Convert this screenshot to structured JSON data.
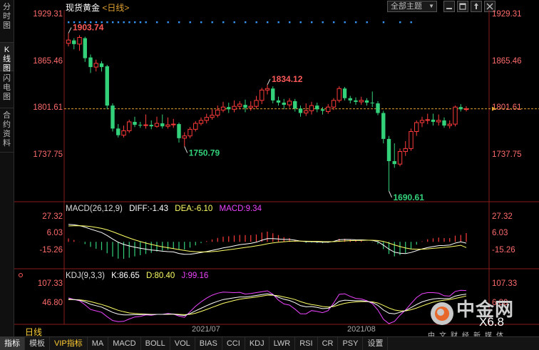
{
  "sidebar": {
    "tabs": [
      {
        "label": "分时图",
        "active": false
      },
      {
        "label": "K线图",
        "active": true
      },
      {
        "label": "闪电图",
        "active": false
      },
      {
        "label": "合约资料",
        "active": false
      }
    ]
  },
  "header": {
    "name": "现货黄金",
    "period": "<日线>",
    "theme_button": "全部主题",
    "theme_arrow": "▼"
  },
  "price_axis": {
    "labels": [
      "1929.31",
      "1865.46",
      "1801.61",
      "1737.75"
    ]
  },
  "price_annotations": {
    "high": "1903.74",
    "mid_high": "1834.12",
    "low1": "1750.79",
    "low2": "1690.61"
  },
  "macd": {
    "name": "MACD(26,12,9)",
    "diff": "DIFF:-1.43",
    "dea": "DEA:-6.10",
    "macd": "MACD:9.34",
    "axis_labels": [
      "27.32",
      "6.03",
      "-15.26"
    ]
  },
  "kdj": {
    "name": "KDJ(9,3,3)",
    "k": "K:86.65",
    "d": "D:80.40",
    "j": "J:99.16",
    "axis_labels": [
      "107.33",
      "46.80"
    ],
    "right_axis_labels": [
      "107.33",
      "6.80"
    ]
  },
  "time_axis": {
    "period_label": "日线",
    "dates": [
      "2021/07",
      "2021/08"
    ]
  },
  "bottom_tabs": [
    {
      "label": "指标",
      "active": true,
      "vip": false
    },
    {
      "label": "模板",
      "active": false,
      "vip": false
    },
    {
      "label": "VIP指标",
      "active": false,
      "vip": true
    },
    {
      "label": "MA",
      "active": false,
      "vip": false
    },
    {
      "label": "MACD",
      "active": false,
      "vip": false
    },
    {
      "label": "BOLL",
      "active": false,
      "vip": false
    },
    {
      "label": "VOL",
      "active": false,
      "vip": false
    },
    {
      "label": "BIAS",
      "active": false,
      "vip": false
    },
    {
      "label": "CCI",
      "active": false,
      "vip": false
    },
    {
      "label": "KDJ",
      "active": false,
      "vip": false
    },
    {
      "label": "LWR",
      "active": false,
      "vip": false
    },
    {
      "label": "RSI",
      "active": false,
      "vip": false
    },
    {
      "label": "CR",
      "active": false,
      "vip": false
    },
    {
      "label": "PSY",
      "active": false,
      "vip": false
    },
    {
      "label": "设置",
      "active": false,
      "vip": false
    }
  ],
  "watermark": {
    "brand": "中金网",
    "sub": "中文财经新媒体",
    "num": "X6.8"
  },
  "colors": {
    "up": "#ff3b3b",
    "down": "#33d17a",
    "axis_text": "#ff6b6b",
    "k_line": "#ffffff",
    "d_line": "#ffff66",
    "j_line": "#ee44ff",
    "dot": "#3399ff"
  },
  "chart_data": [
    {
      "type": "candlestick",
      "title": "现货黄金 <日线>",
      "ylim": [
        1690.61,
        1929.31
      ],
      "annotations": {
        "high": 1903.74,
        "mid_high": 1834.12,
        "low1": 1750.79,
        "low2": 1690.61
      },
      "current_price": 1801.61,
      "candles": [
        [
          1890.0,
          1894.5,
          1886.0,
          1903.74
        ],
        [
          1894.0,
          1889.0,
          1882.0,
          1897.0
        ],
        [
          1889.0,
          1898.0,
          1880.0,
          1901.0
        ],
        [
          1897.0,
          1870.0,
          1865.0,
          1899.0
        ],
        [
          1871.0,
          1858.0,
          1850.0,
          1875.0
        ],
        [
          1858.0,
          1863.0,
          1852.0,
          1868.0
        ],
        [
          1863.0,
          1858.0,
          1852.0,
          1866.0
        ],
        [
          1859.0,
          1806.0,
          1801.0,
          1861.0
        ],
        [
          1806.0,
          1775.0,
          1771.0,
          1809.0
        ],
        [
          1775.0,
          1766.0,
          1763.0,
          1781.0
        ],
        [
          1766.0,
          1772.0,
          1763.0,
          1779.0
        ],
        [
          1772.0,
          1784.0,
          1769.0,
          1787.0
        ],
        [
          1784.0,
          1780.0,
          1777.0,
          1791.0
        ],
        [
          1780.0,
          1779.0,
          1776.0,
          1784.0
        ],
        [
          1780.0,
          1780.0,
          1775.0,
          1794.0
        ],
        [
          1780.0,
          1778.0,
          1774.0,
          1786.0
        ],
        [
          1778.0,
          1782.0,
          1776.0,
          1791.0
        ],
        [
          1782.0,
          1778.0,
          1775.0,
          1794.0
        ],
        [
          1778.0,
          1780.0,
          1775.0,
          1790.0
        ],
        [
          1780.0,
          1781.0,
          1776.0,
          1788.0
        ],
        [
          1781.0,
          1762.0,
          1756.0,
          1783.0
        ],
        [
          1762.0,
          1765.0,
          1750.79,
          1770.0
        ],
        [
          1765.0,
          1774.0,
          1762.0,
          1777.0
        ],
        [
          1774.0,
          1782.0,
          1771.0,
          1785.0
        ],
        [
          1782.0,
          1786.0,
          1779.0,
          1790.0
        ],
        [
          1786.0,
          1790.0,
          1782.0,
          1795.0
        ],
        [
          1790.0,
          1793.0,
          1787.0,
          1801.0
        ],
        [
          1793.0,
          1800.0,
          1790.0,
          1806.0
        ],
        [
          1800.0,
          1804.0,
          1797.0,
          1811.0
        ],
        [
          1804.0,
          1801.0,
          1796.0,
          1810.0
        ],
        [
          1801.0,
          1805.0,
          1797.0,
          1813.0
        ],
        [
          1805.0,
          1808.0,
          1801.0,
          1812.0
        ],
        [
          1807.0,
          1803.0,
          1797.0,
          1814.0
        ],
        [
          1803.0,
          1805.0,
          1799.0,
          1812.0
        ],
        [
          1805.0,
          1813.0,
          1802.0,
          1819.0
        ],
        [
          1813.0,
          1827.0,
          1808.0,
          1830.0
        ],
        [
          1827.0,
          1829.0,
          1821.0,
          1834.12
        ],
        [
          1829.0,
          1813.0,
          1809.0,
          1832.0
        ],
        [
          1813.0,
          1810.0,
          1806.0,
          1818.0
        ],
        [
          1810.0,
          1807.0,
          1801.0,
          1815.0
        ],
        [
          1807.0,
          1812.0,
          1803.0,
          1816.0
        ],
        [
          1812.0,
          1802.0,
          1798.0,
          1815.0
        ],
        [
          1802.0,
          1796.0,
          1791.0,
          1806.0
        ],
        [
          1796.0,
          1799.0,
          1792.0,
          1809.0
        ],
        [
          1799.0,
          1806.0,
          1794.0,
          1811.0
        ],
        [
          1806.0,
          1801.0,
          1797.0,
          1810.0
        ],
        [
          1801.0,
          1799.0,
          1794.0,
          1804.0
        ],
        [
          1798.0,
          1804.0,
          1795.0,
          1808.0
        ],
        [
          1804.0,
          1813.0,
          1800.0,
          1816.0
        ],
        [
          1813.0,
          1829.0,
          1810.0,
          1832.0
        ],
        [
          1829.0,
          1816.0,
          1813.0,
          1831.0
        ],
        [
          1816.0,
          1813.0,
          1809.0,
          1819.0
        ],
        [
          1813.0,
          1811.0,
          1807.0,
          1817.0
        ],
        [
          1811.0,
          1813.0,
          1807.0,
          1818.0
        ],
        [
          1813.0,
          1810.0,
          1806.0,
          1816.0
        ],
        [
          1810.0,
          1809.0,
          1804.0,
          1825.0
        ],
        [
          1809.0,
          1796.0,
          1793.0,
          1812.0
        ],
        [
          1796.0,
          1761.0,
          1755.0,
          1799.0
        ],
        [
          1761.0,
          1731.0,
          1690.61,
          1765.0
        ],
        [
          1731.0,
          1727.0,
          1722.0,
          1755.0
        ],
        [
          1727.0,
          1744.0,
          1724.0,
          1748.0
        ],
        [
          1744.0,
          1748.0,
          1738.0,
          1758.0
        ],
        [
          1748.0,
          1771.0,
          1745.0,
          1775.0
        ],
        [
          1771.0,
          1783.0,
          1765.0,
          1786.0
        ],
        [
          1783.0,
          1786.0,
          1777.0,
          1791.0
        ],
        [
          1786.0,
          1787.0,
          1781.0,
          1795.0
        ],
        [
          1787.0,
          1784.0,
          1779.0,
          1795.0
        ],
        [
          1784.0,
          1786.0,
          1779.0,
          1794.0
        ],
        [
          1786.0,
          1779.0,
          1776.0,
          1790.0
        ],
        [
          1779.0,
          1781.0,
          1775.0,
          1786.0
        ],
        [
          1781.0,
          1804.0,
          1778.0,
          1806.0
        ],
        [
          1804.0,
          1801.0,
          1798.0,
          1808.0
        ],
        [
          1801.0,
          1801.61,
          1798.0,
          1805.0
        ]
      ]
    },
    {
      "type": "bar",
      "name": "MACD(26,12,9)",
      "ylim": [
        -25,
        30
      ],
      "series": [
        {
          "name": "DIFF",
          "values": [
            18.8,
            18.2,
            17.4,
            15.8,
            13.7,
            11.8,
            10.0,
            6.8,
            3.0,
            -0.4,
            -2.8,
            -4.4,
            -5.7,
            -6.8,
            -7.8,
            -8.7,
            -9.3,
            -10.0,
            -10.5,
            -10.8,
            -12.5,
            -13.4,
            -13.2,
            -12.5,
            -11.5,
            -10.4,
            -9.2,
            -7.9,
            -6.5,
            -5.5,
            -4.3,
            -3.1,
            -2.4,
            -1.6,
            -0.4,
            1.7,
            3.4,
            3.4,
            3.1,
            2.6,
            2.6,
            1.8,
            0.8,
            0.2,
            0.2,
            -0.1,
            -0.4,
            -0.3,
            0.5,
            2.2,
            2.6,
            2.5,
            2.2,
            2.1,
            1.8,
            1.5,
            0.2,
            -3.5,
            -7.8,
            -11.1,
            -12.2,
            -12.6,
            -11.4,
            -9.4,
            -7.6,
            -6.1,
            -5.1,
            -4.1,
            -3.9,
            -3.4,
            -1.3,
            0.0,
            -1.43
          ]
        },
        {
          "name": "DEA",
          "values": [
            17.0,
            17.2,
            17.3,
            17.0,
            16.4,
            15.5,
            14.4,
            12.9,
            10.9,
            8.6,
            6.3,
            4.1,
            2.1,
            0.3,
            -1.3,
            -2.8,
            -4.1,
            -5.3,
            -6.3,
            -7.2,
            -8.3,
            -9.3,
            -10.1,
            -10.6,
            -10.8,
            -10.8,
            -10.5,
            -10.0,
            -9.3,
            -8.5,
            -7.7,
            -6.8,
            -6.0,
            -5.2,
            -4.3,
            -3.3,
            -2.1,
            -1.2,
            -0.5,
            0.1,
            0.6,
            0.8,
            0.8,
            0.7,
            0.6,
            0.5,
            0.3,
            0.2,
            0.2,
            0.6,
            1.0,
            1.3,
            1.5,
            1.6,
            1.7,
            1.7,
            1.4,
            0.4,
            -1.3,
            -3.3,
            -5.1,
            -6.6,
            -7.6,
            -7.9,
            -7.9,
            -7.5,
            -7.0,
            -6.4,
            -5.9,
            -5.4,
            -4.6,
            -3.7,
            -6.1
          ]
        },
        {
          "name": "MACD",
          "values": [
            3.6,
            2.0,
            0.2,
            -2.4,
            -5.4,
            -7.4,
            -8.8,
            -12.2,
            -15.8,
            -18.0,
            -18.2,
            -17.0,
            -15.6,
            -14.2,
            -13.0,
            -11.8,
            -10.4,
            -9.4,
            -8.4,
            -7.2,
            -8.4,
            -8.2,
            -6.2,
            -3.8,
            -1.4,
            0.8,
            2.6,
            4.2,
            5.6,
            6.0,
            6.8,
            7.4,
            7.2,
            7.2,
            7.8,
            10.0,
            11.0,
            9.2,
            7.2,
            5.0,
            4.0,
            2.0,
            0.0,
            -1.0,
            -0.8,
            -1.2,
            -1.4,
            -1.0,
            0.6,
            3.2,
            3.2,
            2.4,
            1.4,
            1.0,
            0.2,
            -0.4,
            -2.4,
            -7.8,
            -13.0,
            -15.6,
            -14.2,
            -12.0,
            -7.6,
            -3.0,
            0.6,
            2.8,
            3.8,
            4.6,
            4.0,
            4.0,
            6.6,
            7.4,
            9.34
          ]
        }
      ]
    },
    {
      "type": "line",
      "name": "KDJ(9,3,3)",
      "ylim": [
        -10,
        130
      ],
      "series": [
        {
          "name": "K",
          "values": [
            70,
            68,
            66,
            60,
            52,
            47,
            42,
            33,
            24,
            18,
            15,
            15,
            16,
            16,
            17,
            16,
            17,
            17,
            18,
            18,
            15,
            13,
            20,
            29,
            38,
            47,
            55,
            62,
            68,
            71,
            74,
            77,
            77,
            79,
            82,
            85,
            88,
            84,
            76,
            69,
            65,
            57,
            47,
            43,
            44,
            41,
            37,
            38,
            48,
            62,
            66,
            65,
            64,
            64,
            62,
            58,
            48,
            32,
            21,
            19,
            24,
            30,
            40,
            51,
            60,
            66,
            70,
            72,
            71,
            72,
            80,
            84,
            86.65
          ]
        },
        {
          "name": "D",
          "values": [
            68,
            68,
            67,
            65,
            61,
            56,
            51,
            45,
            38,
            31,
            26,
            22,
            20,
            19,
            18,
            17,
            17,
            17,
            17,
            18,
            17,
            16,
            17,
            21,
            27,
            34,
            41,
            48,
            55,
            60,
            65,
            69,
            72,
            74,
            77,
            80,
            83,
            83,
            81,
            77,
            73,
            68,
            61,
            55,
            51,
            48,
            44,
            42,
            44,
            50,
            55,
            58,
            60,
            61,
            61,
            60,
            56,
            48,
            39,
            32,
            29,
            29,
            33,
            39,
            46,
            53,
            59,
            63,
            66,
            68,
            72,
            76,
            80.4
          ]
        },
        {
          "name": "J",
          "values": [
            74,
            68,
            64,
            50,
            34,
            29,
            24,
            9,
            -4,
            -8,
            -7,
            1,
            8,
            10,
            15,
            14,
            17,
            17,
            20,
            18,
            11,
            7,
            26,
            45,
            60,
            73,
            83,
            90,
            94,
            93,
            92,
            93,
            87,
            89,
            92,
            95,
            98,
            86,
            66,
            53,
            49,
            35,
            19,
            19,
            30,
            27,
            23,
            30,
            56,
            86,
            88,
            79,
            72,
            70,
            64,
            54,
            32,
            0,
            -15,
            -7,
            14,
            32,
            54,
            75,
            88,
            92,
            92,
            90,
            81,
            80,
            96,
            100,
            99.16
          ]
        }
      ]
    }
  ]
}
